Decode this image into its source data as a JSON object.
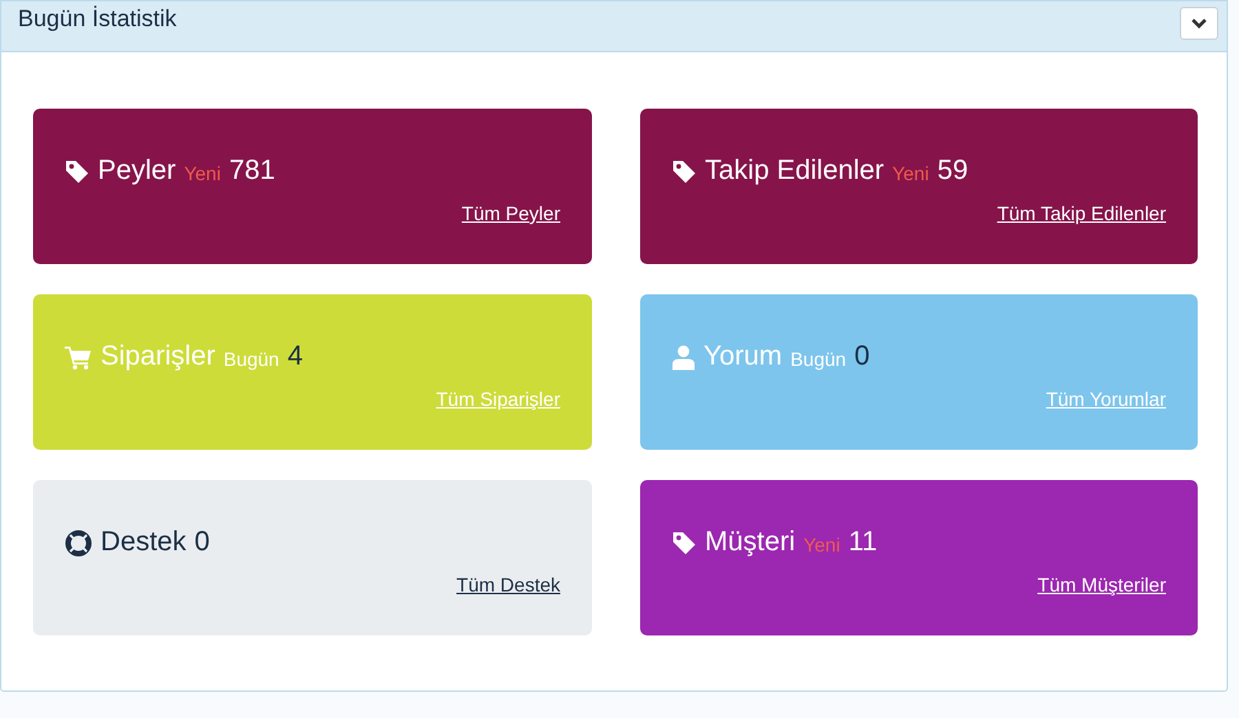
{
  "panel": {
    "title": "Bugün İstatistik"
  },
  "cards": [
    {
      "kind": "tag",
      "title": "Peyler",
      "badge": {
        "text": "Yeni",
        "kind": "new"
      },
      "count": "781",
      "color": "#86144a",
      "text_dark": false,
      "count_dark": false,
      "link": "Tüm Peyler"
    },
    {
      "kind": "tag",
      "title": "Takip Edilenler",
      "badge": {
        "text": "Yeni",
        "kind": "new"
      },
      "count": "59",
      "color": "#86144a",
      "text_dark": false,
      "count_dark": false,
      "link": "Tüm Takip Edilenler"
    },
    {
      "kind": "cart",
      "title": "Siparişler",
      "badge": {
        "text": "Bugün",
        "kind": "today"
      },
      "count": "4",
      "color": "#cddc39",
      "text_dark": false,
      "count_dark": true,
      "link": "Tüm Siparişler"
    },
    {
      "kind": "user",
      "title": "Yorum",
      "badge": {
        "text": "Bugün",
        "kind": "today"
      },
      "count": "0",
      "color": "#7dc5ec",
      "text_dark": false,
      "count_dark": true,
      "link": "Tüm Yorumlar"
    },
    {
      "kind": "lifebuoy",
      "title": "Destek",
      "count": "0",
      "color": "#eaedf0",
      "text_dark": true,
      "count_dark": true,
      "link": "Tüm Destek"
    },
    {
      "kind": "tag",
      "title": "Müşteri",
      "badge": {
        "text": "Yeni",
        "kind": "new"
      },
      "count": "11",
      "color": "#9c27b0",
      "text_dark": false,
      "count_dark": false,
      "link": "Tüm Müşteriler"
    }
  ]
}
